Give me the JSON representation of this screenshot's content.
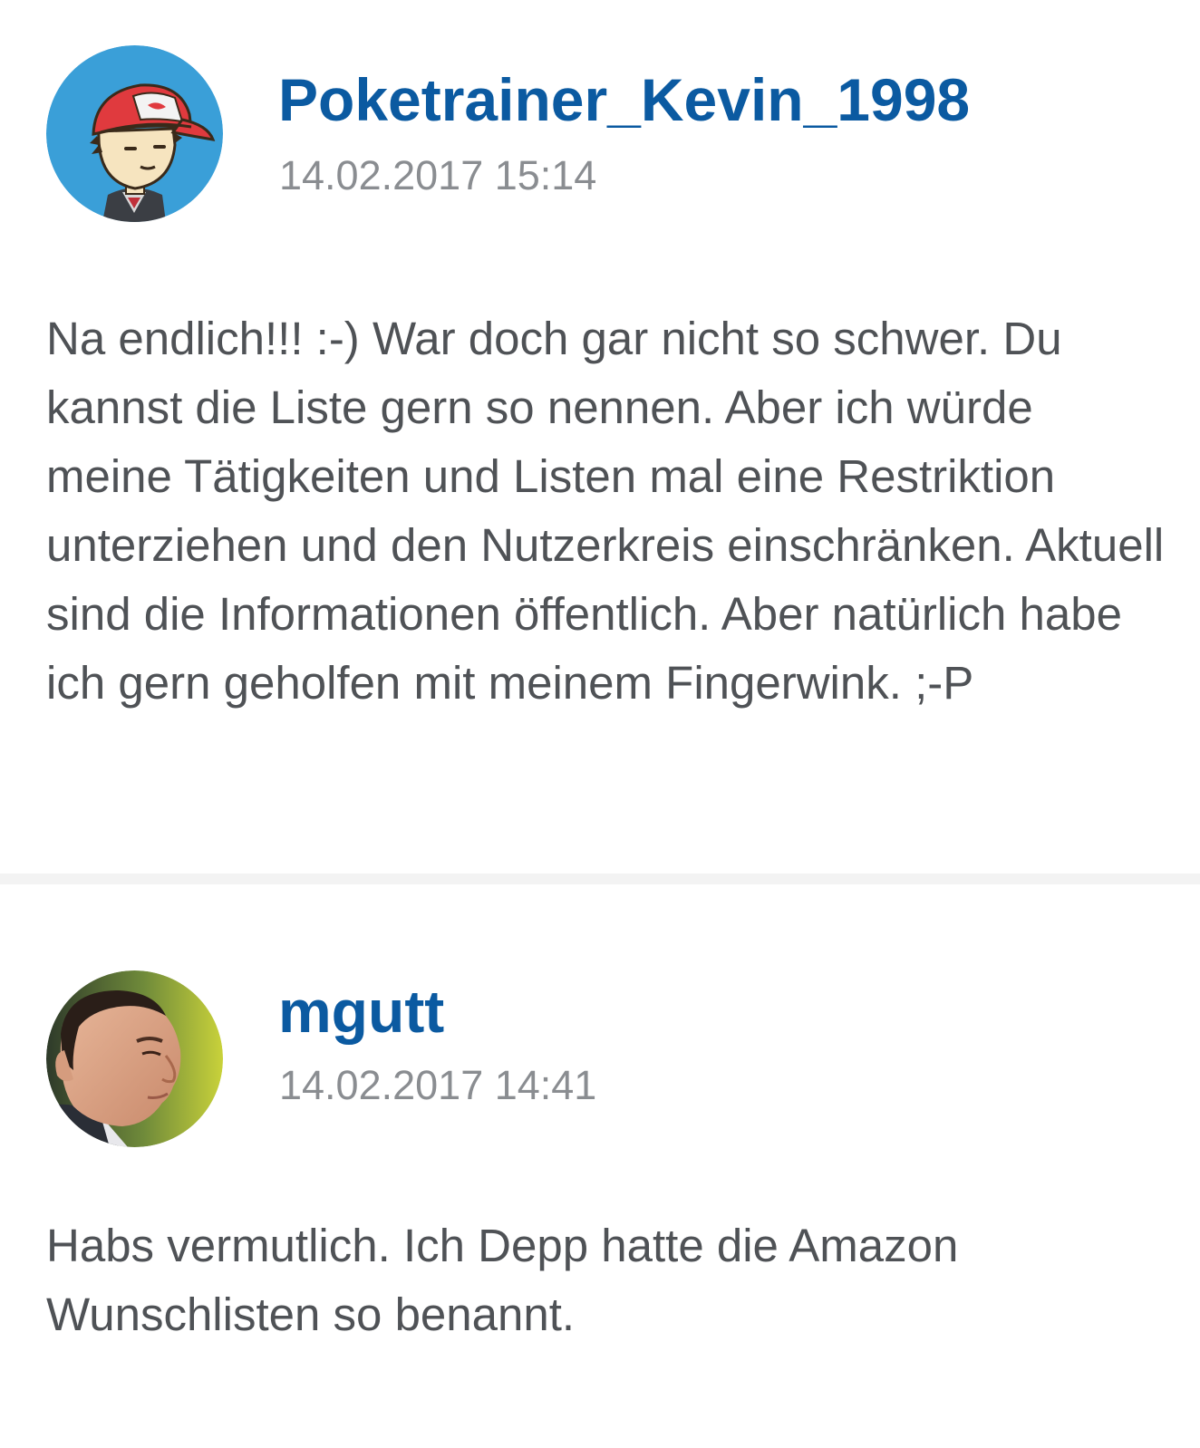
{
  "comments": [
    {
      "username": "Poketrainer_Kevin_1998",
      "timestamp": "14.02.2017 15:14",
      "avatar_icon": "cartoon-trainer-avatar",
      "text": "Na endlich!!! :-) War doch gar nicht so schwer. Du kannst die Liste gern so nennen. Aber ich würde meine Tätigkeiten und Listen mal eine Restriktion unterziehen und den Nutzerkreis einschränken. Aktuell sind die Informationen öffentlich. Aber natürlich habe ich gern geholfen mit meinem Fingerwink. ;-P"
    },
    {
      "username": "mgutt",
      "timestamp": "14.02.2017 14:41",
      "avatar_icon": "profile-photo-avatar",
      "text": "Habs vermutlich. Ich Depp hatte die Amazon Wunschlisten so benannt."
    }
  ],
  "colors": {
    "username": "#0b5aa1",
    "timestamp": "#8a8d91",
    "body_text": "#4f5256",
    "divider": "#f3f3f3"
  }
}
